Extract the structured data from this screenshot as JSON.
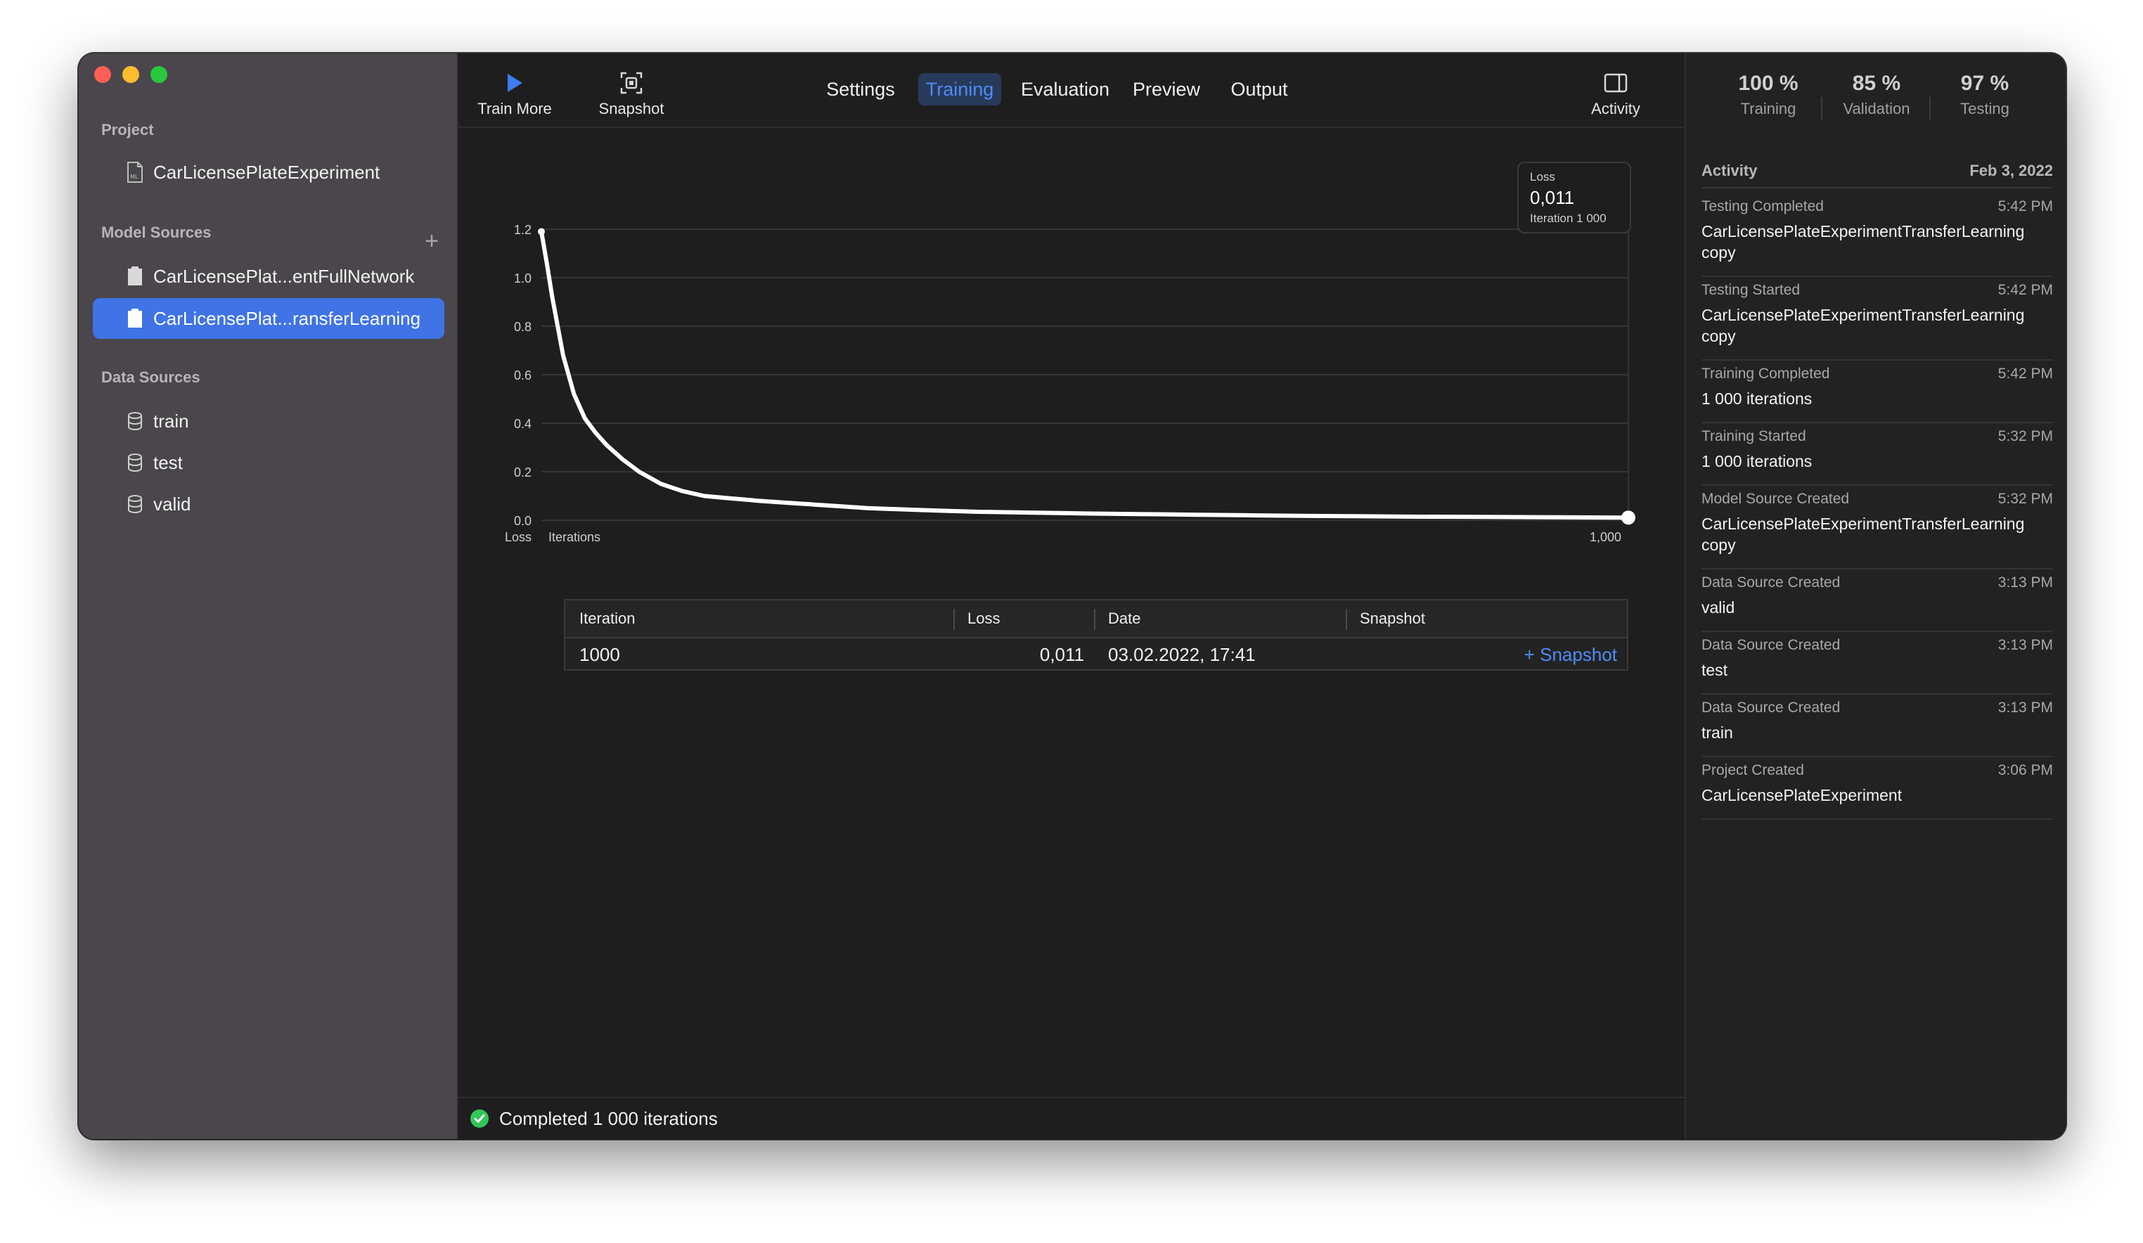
{
  "sidebar": {
    "project_header": "Project",
    "project_name": "CarLicensePlateExperiment",
    "model_sources_header": "Model Sources",
    "add_icon": "plus-icon",
    "model_sources": [
      {
        "label": "CarLicensePlat...entFullNetwork"
      },
      {
        "label": "CarLicensePlat...ransferLearning"
      }
    ],
    "data_sources_header": "Data Sources",
    "data_sources": [
      {
        "label": "train"
      },
      {
        "label": "test"
      },
      {
        "label": "valid"
      }
    ]
  },
  "toolbar": {
    "train_more_label": "Train More",
    "snapshot_label": "Snapshot",
    "activity_label": "Activity",
    "tabs": [
      {
        "label": "Settings"
      },
      {
        "label": "Training"
      },
      {
        "label": "Evaluation"
      },
      {
        "label": "Preview"
      },
      {
        "label": "Output"
      }
    ],
    "active_tab": "Training",
    "accent_color": "#4f8cf7"
  },
  "loss_box": {
    "title": "Loss",
    "value": "0,011",
    "iteration": "Iteration 1 000"
  },
  "chart_data": {
    "type": "line",
    "xlabel": "Iterations",
    "ylabel": "Loss",
    "y_ticks": [
      "1.2",
      "1.0",
      "0.8",
      "0.6",
      "0.4",
      "0.2",
      "0.0"
    ],
    "x_tick_end": "1,000",
    "xlim": [
      0,
      1000
    ],
    "ylim": [
      0,
      1.2
    ],
    "grid": true,
    "series": [
      {
        "x": [
          0,
          5,
          10,
          15,
          20,
          30,
          40,
          50,
          60,
          75,
          90,
          110,
          130,
          150,
          175,
          200,
          250,
          300,
          350,
          400,
          500,
          600,
          700,
          800,
          900,
          1000
        ],
        "y": [
          1.19,
          1.06,
          0.92,
          0.8,
          0.68,
          0.52,
          0.42,
          0.36,
          0.31,
          0.25,
          0.2,
          0.15,
          0.12,
          0.1,
          0.09,
          0.08,
          0.065,
          0.05,
          0.042,
          0.035,
          0.028,
          0.023,
          0.018,
          0.015,
          0.013,
          0.011
        ]
      }
    ],
    "line_color": "#ffffff"
  },
  "table": {
    "headers": [
      "Iteration",
      "Loss",
      "Date",
      "Snapshot"
    ],
    "rows": [
      {
        "iteration": "1000",
        "loss": "0,011",
        "date": "03.02.2022, 17:41",
        "snapshot": "+ Snapshot"
      }
    ]
  },
  "status": {
    "text": "Completed 1 000 iterations",
    "color": "#32c75a"
  },
  "metrics": [
    {
      "value": "100 %",
      "label": "Training"
    },
    {
      "value": "85 %",
      "label": "Validation"
    },
    {
      "value": "97 %",
      "label": "Testing"
    }
  ],
  "activity": {
    "header": "Activity",
    "date": "Feb 3, 2022",
    "items": [
      {
        "title": "Testing Completed",
        "time": "5:42 PM",
        "detail": "CarLicensePlateExperimentTransferLearning copy"
      },
      {
        "title": "Testing Started",
        "time": "5:42 PM",
        "detail": "CarLicensePlateExperimentTransferLearning copy"
      },
      {
        "title": "Training Completed",
        "time": "5:42 PM",
        "detail": "1 000 iterations"
      },
      {
        "title": "Training Started",
        "time": "5:32 PM",
        "detail": "1 000 iterations"
      },
      {
        "title": "Model Source Created",
        "time": "5:32 PM",
        "detail": "CarLicensePlateExperimentTransferLearning copy"
      },
      {
        "title": "Data Source Created",
        "time": "3:13 PM",
        "detail": "valid"
      },
      {
        "title": "Data Source Created",
        "time": "3:13 PM",
        "detail": "test"
      },
      {
        "title": "Data Source Created",
        "time": "3:13 PM",
        "detail": "train"
      },
      {
        "title": "Project Created",
        "time": "3:06 PM",
        "detail": "CarLicensePlateExperiment"
      }
    ]
  }
}
